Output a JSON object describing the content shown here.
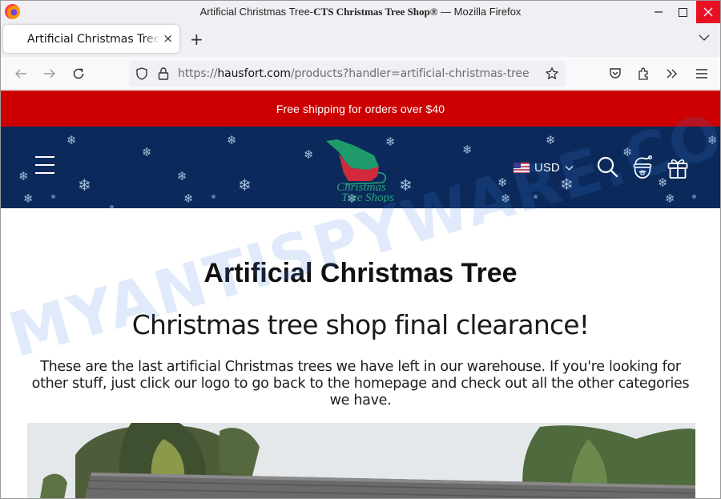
{
  "window": {
    "title_plain": "Artificial Christmas Tree-",
    "title_serif": "CTS Christmas Tree Shop®",
    "title_suffix": " — Mozilla Firefox"
  },
  "tabs": [
    {
      "label": "Artificial Christmas Tree-CTS Christmas Tree Shop®",
      "active": true
    }
  ],
  "tab_close_label": "×",
  "new_tab_label": "+",
  "urlbar": {
    "scheme": "https://",
    "host": "hausfort.com",
    "path": "/products?handler=artificial-christmas-tree"
  },
  "promo": {
    "text": "Free shipping for orders over $40",
    "background": "#cc0000"
  },
  "header": {
    "background": "#0b2a5b",
    "logo_alt": "Christmas Tree Shops",
    "logo_line1": "Christmas",
    "logo_line2": "Tree Shops",
    "currency": "USD"
  },
  "main": {
    "title": "Artificial Christmas Tree",
    "subtitle": "Christmas tree shop final clearance!",
    "description": "These are the last artificial Christmas trees we have left in our warehouse. If you're looking for other stuff, just click our logo to go back to the homepage and check out all the other categories we have."
  },
  "watermark": {
    "text": "MYANTISPYWARE.COM"
  }
}
